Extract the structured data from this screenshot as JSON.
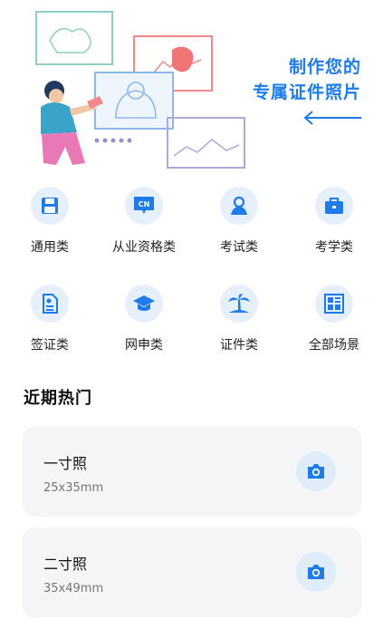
{
  "banner": {
    "line1": "制作您的",
    "line2": "专属证件照片"
  },
  "colors": {
    "accent": "#1d7bea",
    "icon_bg": "#e6f0fc",
    "card_bg": "#f4f5f7"
  },
  "categories": [
    {
      "label": "通用类",
      "icon": "save-disk-icon"
    },
    {
      "label": "从业资格类",
      "icon": "cn-badge-icon",
      "badge_text": "CN"
    },
    {
      "label": "考试类",
      "icon": "person-id-icon"
    },
    {
      "label": "考学类",
      "icon": "briefcase-icon"
    },
    {
      "label": "签证类",
      "icon": "visa-document-icon"
    },
    {
      "label": "网申类",
      "icon": "graduation-cap-icon"
    },
    {
      "label": "证件类",
      "icon": "palm-tree-icon"
    },
    {
      "label": "全部场景",
      "icon": "all-scenes-grid-icon"
    }
  ],
  "hot": {
    "title": "近期热门",
    "items": [
      {
        "name": "一寸照",
        "size": "25x35mm",
        "icon": "camera-icon"
      },
      {
        "name": "二寸照",
        "size": "35x49mm",
        "icon": "camera-icon"
      }
    ]
  }
}
